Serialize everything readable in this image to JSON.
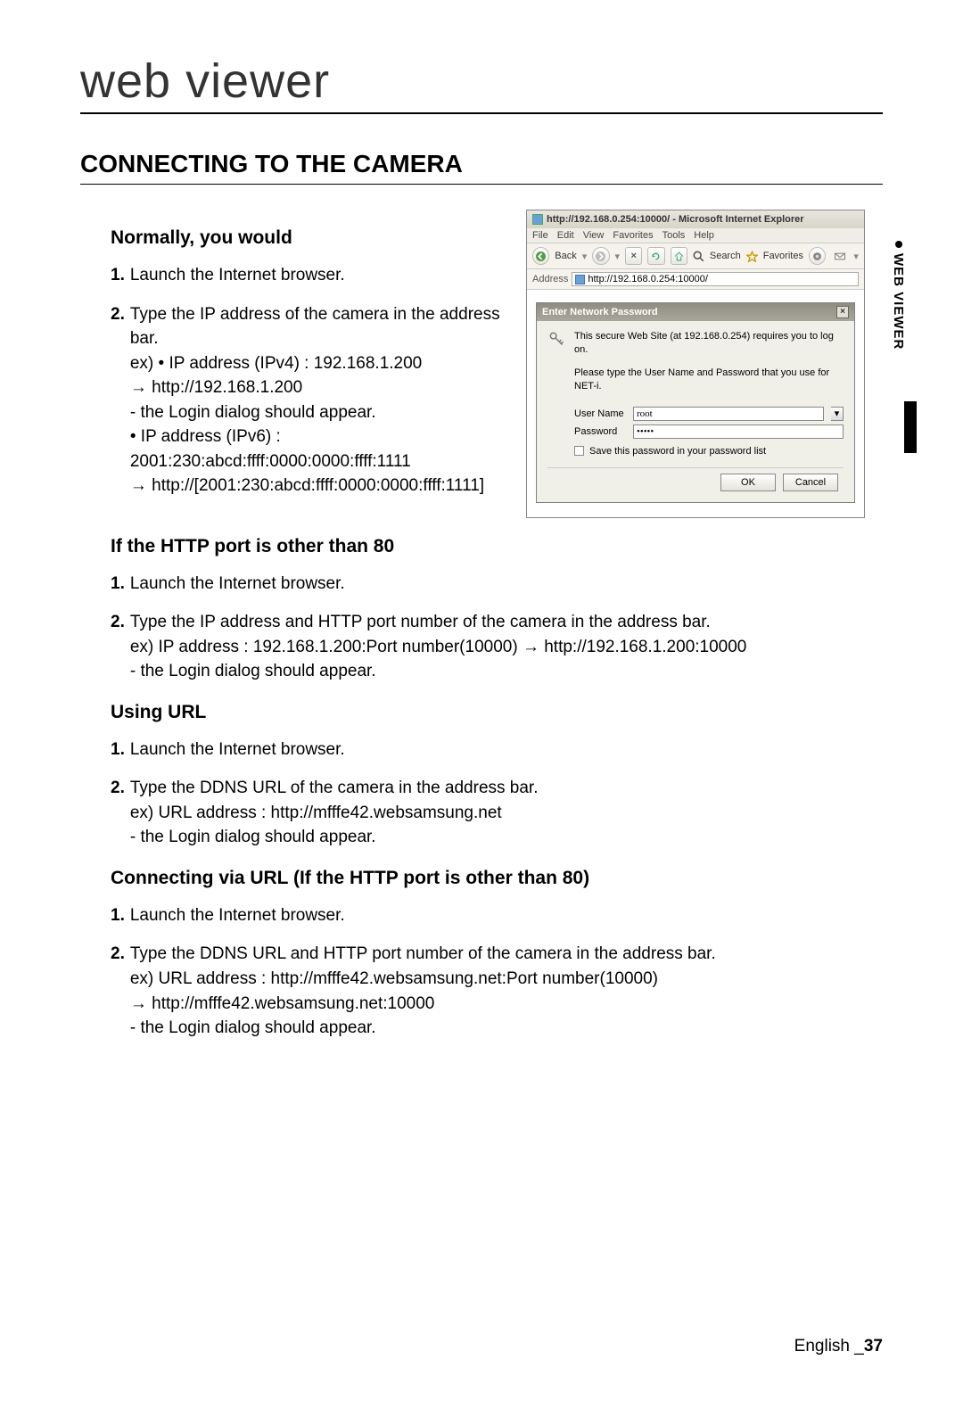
{
  "header": {
    "title": "web viewer"
  },
  "section": {
    "heading": "CONNECTING TO THE CAMERA"
  },
  "normally": {
    "heading": "Normally, you would",
    "steps": [
      {
        "num": "1.",
        "body": "Launch the Internet browser."
      },
      {
        "num": "2.",
        "body": "Type the IP address of the camera in the address bar.\nex) • IP address (IPv4) : 192.168.1.200\n→ http://192.168.1.200\n- the Login dialog should appear.\n• IP address (IPv6) : 2001:230:abcd:ffff:0000:0000:ffff:1111\n→ http://[2001:230:abcd:ffff:0000:0000:ffff:1111]"
      }
    ]
  },
  "http_port": {
    "heading": "If the HTTP port is other than 80",
    "steps": [
      {
        "num": "1.",
        "body": "Launch the Internet browser."
      },
      {
        "num": "2.",
        "body": "Type the IP address and HTTP port number of the camera in the address bar.\nex) IP address : 192.168.1.200:Port number(10000) → http://192.168.1.200:10000\n- the Login dialog should appear."
      }
    ]
  },
  "using_url": {
    "heading": "Using URL",
    "steps": [
      {
        "num": "1.",
        "body": "Launch the Internet browser."
      },
      {
        "num": "2.",
        "body": "Type the DDNS URL of the camera in the address bar.\nex) URL address : http://mfffe42.websamsung.net\n- the Login dialog should appear."
      }
    ]
  },
  "via_url_port": {
    "heading": "Connecting via URL (If the HTTP port is other than 80)",
    "steps": [
      {
        "num": "1.",
        "body": "Launch the Internet browser."
      },
      {
        "num": "2.",
        "body": "Type the DDNS URL and HTTP port number of the camera in the address bar.\nex) URL address : http://mfffe42.websamsung.net:Port number(10000)\n→ http://mfffe42.websamsung.net:10000\n- the Login dialog should appear."
      }
    ]
  },
  "screenshot": {
    "window_title": "http://192.168.0.254:10000/ - Microsoft Internet Explorer",
    "menu": [
      "File",
      "Edit",
      "View",
      "Favorites",
      "Tools",
      "Help"
    ],
    "toolbar": {
      "back": "Back",
      "search": "Search",
      "favorites": "Favorites"
    },
    "address_label": "Address",
    "address_value": "http://192.168.0.254:10000/",
    "dialog": {
      "title": "Enter Network Password",
      "line1": "This secure Web Site (at 192.168.0.254) requires you to log on.",
      "line2": "Please type the User Name and Password that you use for NET-i.",
      "user_label": "User Name",
      "user_value": "root",
      "pass_label": "Password",
      "pass_value": "•••••",
      "save_label": "Save this password in your password list",
      "ok": "OK",
      "cancel": "Cancel"
    }
  },
  "side_tab": "WEB VIEWER",
  "footer": {
    "lang": "English",
    "sep": "_",
    "page": "37"
  }
}
